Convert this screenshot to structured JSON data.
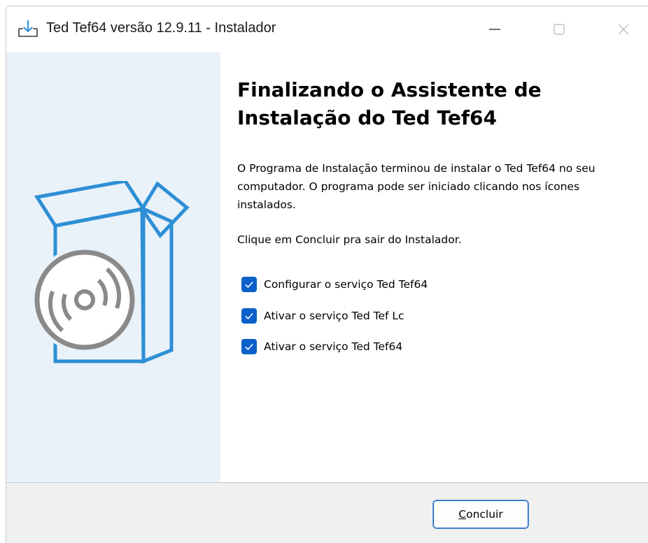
{
  "window": {
    "title": "Ted Tef64 versão 12.9.11 - Instalador",
    "app_icon": "installer-download-icon",
    "controls": {
      "minimize": "minimize-icon",
      "maximize": "maximize-icon",
      "close": "close-icon"
    }
  },
  "side_panel": {
    "image": "box-with-cd-icon",
    "background": "#e9f1f9",
    "accent": "#2d8fd5"
  },
  "content": {
    "heading_line1": "Finalizando o Assistente de",
    "heading_line2": "Instalação do Ted Tef64",
    "paragraph1": "O Programa de Instalação terminou de instalar o Ted Tef64 no seu computador. O programa pode ser iniciado clicando nos ícones instalados.",
    "paragraph2": "Clique em Concluir pra sair do Instalador.",
    "options": [
      {
        "label": "Configurar o serviço Ted Tef64",
        "checked": true
      },
      {
        "label": "Ativar o serviço Ted Tef Lc",
        "checked": true
      },
      {
        "label": "Ativar o serviço Ted Tef64",
        "checked": true
      }
    ]
  },
  "footer": {
    "finish_button": {
      "mnemonic": "C",
      "rest": "oncluir"
    }
  },
  "colors": {
    "checkbox": "#0a60c9",
    "button_border": "#0a60c9",
    "footer": "#f0f0f0"
  }
}
